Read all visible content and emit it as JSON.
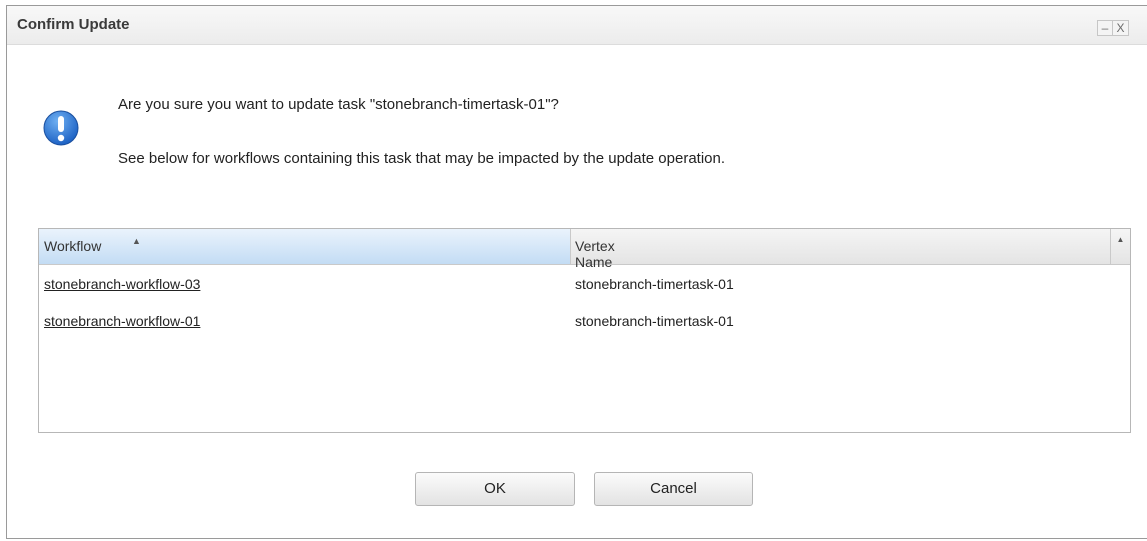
{
  "window": {
    "title": "Confirm Update",
    "minimize_glyph": "–",
    "close_glyph": "X"
  },
  "message": {
    "icon": "info-icon",
    "icon_color": "#2d7bd6",
    "line1": "Are you sure you want to update task \"stonebranch-timertask-01\"?",
    "line2": "See below for workflows containing this task that may be impacted by the update operation."
  },
  "grid": {
    "columns": [
      {
        "label": "Workflow",
        "sort": "ascending"
      },
      {
        "label": "Vertex Name"
      }
    ],
    "rows": [
      {
        "workflow": "stonebranch-workflow-03",
        "vertex": "stonebranch-timertask-01"
      },
      {
        "workflow": "stonebranch-workflow-01",
        "vertex": "stonebranch-timertask-01"
      }
    ]
  },
  "buttons": {
    "ok": "OK",
    "cancel": "Cancel"
  }
}
